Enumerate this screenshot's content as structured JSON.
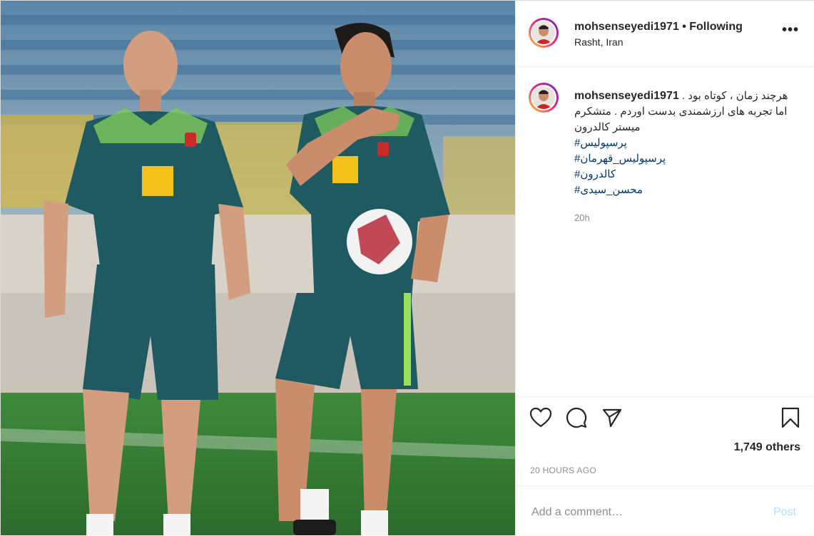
{
  "header": {
    "username": "mohsenseyedi1971",
    "separator": " • ",
    "follow_status": "Following",
    "location": "Rasht, Iran",
    "more_icon": "ellipsis-icon"
  },
  "caption": {
    "username": "mohsenseyedi1971",
    "text": "هرچند زمان ، کوتاه بود . اما تجربه های ارزشمندی بدست اوردم . متشکرم میستر کالدرون",
    "hashtags": [
      "#پرسپولیس",
      "#پرسپولیس_قهرمان",
      "#کالدرون",
      "#محسن_سیدی"
    ],
    "time": "20h"
  },
  "actions": {
    "like_icon": "heart-icon",
    "comment_icon": "comment-icon",
    "share_icon": "paper-plane-icon",
    "save_icon": "bookmark-icon",
    "likes": "1,749 others",
    "timestamp": "20 HOURS AGO"
  },
  "comment": {
    "placeholder": "Add a comment…",
    "post_label": "Post"
  },
  "colors": {
    "link": "#00376b",
    "post_button_disabled": "#b2dffc",
    "jersey": "#1f5a63",
    "accent_green": "#9be05a"
  }
}
